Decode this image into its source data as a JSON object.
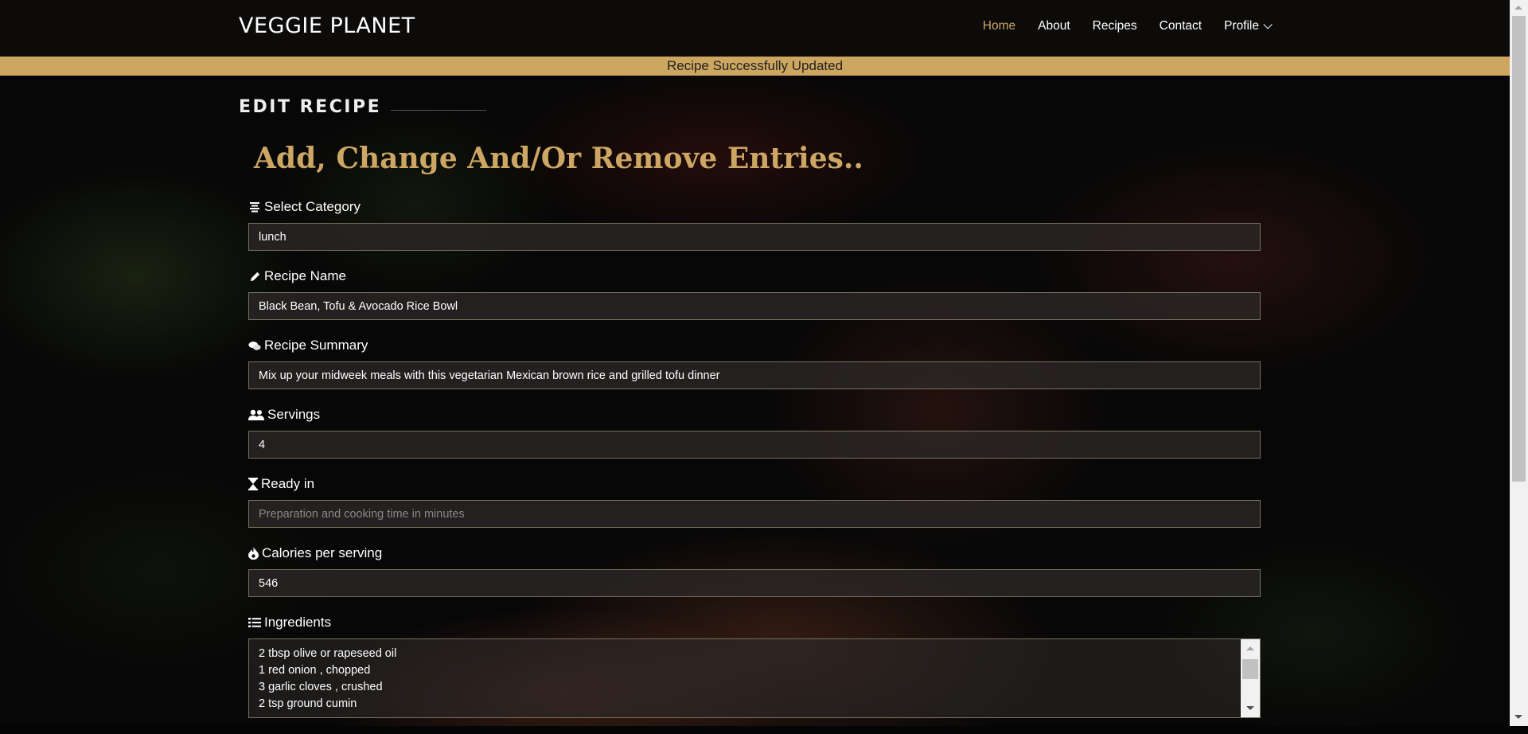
{
  "brand": "VEGGIE PLANET",
  "nav": {
    "items": [
      {
        "label": "Home",
        "active": true
      },
      {
        "label": "About"
      },
      {
        "label": "Recipes"
      },
      {
        "label": "Contact"
      },
      {
        "label": "Profile",
        "has_dropdown": true
      }
    ]
  },
  "alert": "Recipe Successfully Updated",
  "section_title": "EDIT RECIPE",
  "heading": "Add, Change And/Or Remove Entries..",
  "form": {
    "category": {
      "label": "Select Category",
      "icon": "align-center-icon",
      "value": "lunch"
    },
    "recipe_name": {
      "label": "Recipe Name",
      "icon": "pencil-icon",
      "value": "Black Bean, Tofu & Avocado Rice Bowl"
    },
    "summary": {
      "label": "Recipe Summary",
      "icon": "comments-icon",
      "value": "Mix up your midweek meals with this vegetarian Mexican brown rice and grilled tofu dinner"
    },
    "servings": {
      "label": "Servings",
      "icon": "users-icon",
      "value": "4"
    },
    "ready_in": {
      "label": "Ready in",
      "icon": "hourglass-icon",
      "value": "",
      "placeholder": "Preparation and cooking time in minutes"
    },
    "calories": {
      "label": "Calories per serving",
      "icon": "fire-icon",
      "value": "546"
    },
    "ingredients": {
      "label": "Ingredients",
      "icon": "list-icon",
      "value": "2 tbsp olive or rapeseed oil\n1 red onion , chopped\n3 garlic cloves , crushed\n2 tsp ground cumin"
    }
  },
  "colors": {
    "accent": "#cda664",
    "alert_bg": "#cda660",
    "navbar_bg": "#0c0b0a"
  }
}
